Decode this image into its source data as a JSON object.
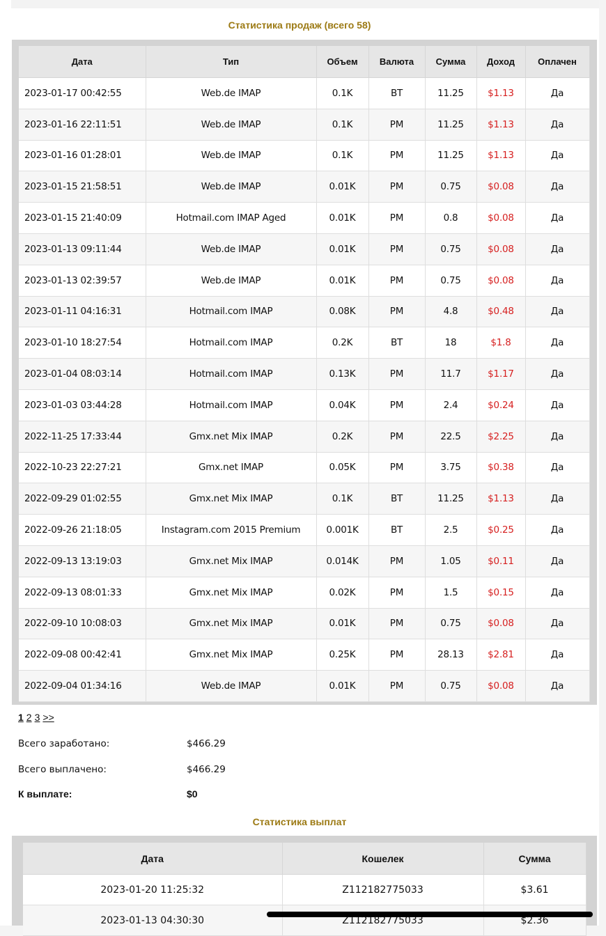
{
  "sales": {
    "title": "Статистика продаж (всего 58)",
    "headers": [
      "Дата",
      "Тип",
      "Объем",
      "Валюта",
      "Сумма",
      "Доход",
      "Оплачен"
    ],
    "rows": [
      {
        "date": "2023-01-17 00:42:55",
        "type": "Web.de IMAP",
        "volume": "0.1K",
        "currency": "BT",
        "sum": "11.25",
        "income": "$1.13",
        "paid": "Да"
      },
      {
        "date": "2023-01-16 22:11:51",
        "type": "Web.de IMAP",
        "volume": "0.1K",
        "currency": "PM",
        "sum": "11.25",
        "income": "$1.13",
        "paid": "Да"
      },
      {
        "date": "2023-01-16 01:28:01",
        "type": "Web.de IMAP",
        "volume": "0.1K",
        "currency": "PM",
        "sum": "11.25",
        "income": "$1.13",
        "paid": "Да"
      },
      {
        "date": "2023-01-15 21:58:51",
        "type": "Web.de IMAP",
        "volume": "0.01K",
        "currency": "PM",
        "sum": "0.75",
        "income": "$0.08",
        "paid": "Да"
      },
      {
        "date": "2023-01-15 21:40:09",
        "type": "Hotmail.com IMAP Aged",
        "volume": "0.01K",
        "currency": "PM",
        "sum": "0.8",
        "income": "$0.08",
        "paid": "Да"
      },
      {
        "date": "2023-01-13 09:11:44",
        "type": "Web.de IMAP",
        "volume": "0.01K",
        "currency": "PM",
        "sum": "0.75",
        "income": "$0.08",
        "paid": "Да"
      },
      {
        "date": "2023-01-13 02:39:57",
        "type": "Web.de IMAP",
        "volume": "0.01K",
        "currency": "PM",
        "sum": "0.75",
        "income": "$0.08",
        "paid": "Да"
      },
      {
        "date": "2023-01-11 04:16:31",
        "type": "Hotmail.com IMAP",
        "volume": "0.08K",
        "currency": "PM",
        "sum": "4.8",
        "income": "$0.48",
        "paid": "Да"
      },
      {
        "date": "2023-01-10 18:27:54",
        "type": "Hotmail.com IMAP",
        "volume": "0.2K",
        "currency": "BT",
        "sum": "18",
        "income": "$1.8",
        "paid": "Да"
      },
      {
        "date": "2023-01-04 08:03:14",
        "type": "Hotmail.com IMAP",
        "volume": "0.13K",
        "currency": "PM",
        "sum": "11.7",
        "income": "$1.17",
        "paid": "Да"
      },
      {
        "date": "2023-01-03 03:44:28",
        "type": "Hotmail.com IMAP",
        "volume": "0.04K",
        "currency": "PM",
        "sum": "2.4",
        "income": "$0.24",
        "paid": "Да"
      },
      {
        "date": "2022-11-25 17:33:44",
        "type": "Gmx.net Mix IMAP",
        "volume": "0.2K",
        "currency": "PM",
        "sum": "22.5",
        "income": "$2.25",
        "paid": "Да"
      },
      {
        "date": "2022-10-23 22:27:21",
        "type": "Gmx.net IMAP",
        "volume": "0.05K",
        "currency": "PM",
        "sum": "3.75",
        "income": "$0.38",
        "paid": "Да"
      },
      {
        "date": "2022-09-29 01:02:55",
        "type": "Gmx.net Mix IMAP",
        "volume": "0.1K",
        "currency": "BT",
        "sum": "11.25",
        "income": "$1.13",
        "paid": "Да"
      },
      {
        "date": "2022-09-26 21:18:05",
        "type": "Instagram.com 2015 Premium",
        "volume": "0.001K",
        "currency": "BT",
        "sum": "2.5",
        "income": "$0.25",
        "paid": "Да"
      },
      {
        "date": "2022-09-13 13:19:03",
        "type": "Gmx.net Mix IMAP",
        "volume": "0.014K",
        "currency": "PM",
        "sum": "1.05",
        "income": "$0.11",
        "paid": "Да"
      },
      {
        "date": "2022-09-13 08:01:33",
        "type": "Gmx.net Mix IMAP",
        "volume": "0.02K",
        "currency": "PM",
        "sum": "1.5",
        "income": "$0.15",
        "paid": "Да"
      },
      {
        "date": "2022-09-10 10:08:03",
        "type": "Gmx.net Mix IMAP",
        "volume": "0.01K",
        "currency": "PM",
        "sum": "0.75",
        "income": "$0.08",
        "paid": "Да"
      },
      {
        "date": "2022-09-08 00:42:41",
        "type": "Gmx.net Mix IMAP",
        "volume": "0.25K",
        "currency": "PM",
        "sum": "28.13",
        "income": "$2.81",
        "paid": "Да"
      },
      {
        "date": "2022-09-04 01:34:16",
        "type": "Web.de IMAP",
        "volume": "0.01K",
        "currency": "PM",
        "sum": "0.75",
        "income": "$0.08",
        "paid": "Да"
      }
    ]
  },
  "pagination": {
    "pages": [
      "1",
      "2",
      "3"
    ],
    "current": "1",
    "next": ">>"
  },
  "summary": {
    "earned_label": "Всего заработано:",
    "earned_value": "$466.29",
    "paid_label": "Всего выплачено:",
    "paid_value": "$466.29",
    "due_label": "К выплате:",
    "due_value": "$0"
  },
  "payouts": {
    "title": "Статистика выплат",
    "headers": [
      "Дата",
      "Кошелек",
      "Сумма"
    ],
    "rows": [
      {
        "date": "2023-01-20 11:25:32",
        "wallet": "Z112182775033",
        "amount": "$3.61"
      },
      {
        "date": "2023-01-13 04:30:30",
        "wallet": "Z112182775033",
        "amount": "$2.36"
      }
    ]
  },
  "colors": {
    "title": "#9c7a14",
    "income": "#d61f1f",
    "frame": "#d3d3d3",
    "header_bg": "#e6e6e6"
  }
}
